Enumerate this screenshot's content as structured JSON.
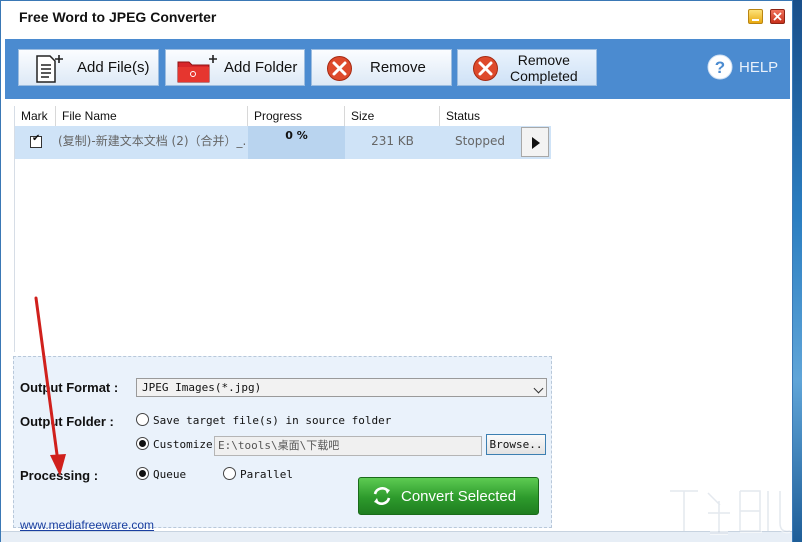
{
  "window": {
    "title": "Free Word to JPEG Converter"
  },
  "toolbar": {
    "add_files": "Add File(s)",
    "add_folder": "Add Folder",
    "remove": "Remove",
    "remove_completed_line1": "Remove",
    "remove_completed_line2": "Completed",
    "help": "HELP"
  },
  "file_list": {
    "columns": [
      "Mark",
      "File Name",
      "Progress",
      "Size",
      "Status"
    ],
    "rows": [
      {
        "checked": true,
        "file_name": "(复制)-新建文本文档 (2)（合并）_...",
        "progress": "0 %",
        "size": "231 KB",
        "status": "Stopped"
      }
    ]
  },
  "options": {
    "output_format_label": "Output Format :",
    "output_format_value": "JPEG Images(*.jpg)",
    "output_folder_label": "Output Folder :",
    "save_in_source": "Save target file(s) in source folder",
    "customize": "Customize",
    "customize_path": "E:\\tools\\桌面\\下载吧",
    "browse": "Browse..",
    "processing_label": "Processing :",
    "queue": "Queue",
    "parallel": "Parallel",
    "selected_output_folder": "customize",
    "selected_processing": "queue"
  },
  "actions": {
    "convert_selected": "Convert Selected"
  },
  "footer": {
    "link": "www.mediafreeware.com"
  },
  "colors": {
    "toolbar_bg": "#4b8bd0",
    "selected_row": "#cfe3f7",
    "convert_green": "#2d9a2c",
    "remove_red": "#d9452a",
    "annotation_arrow": "#d0201c"
  }
}
